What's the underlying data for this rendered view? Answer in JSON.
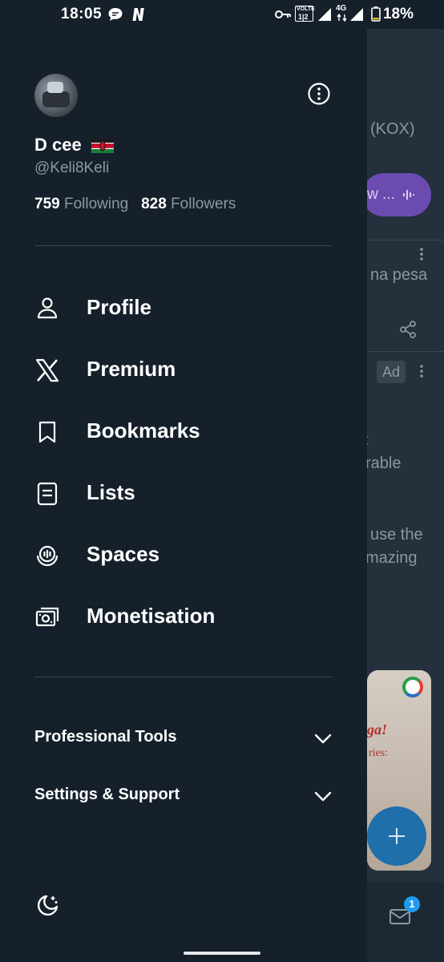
{
  "status_bar": {
    "time": "18:05",
    "battery": "18%",
    "network": "4G",
    "volte": "VOLTE"
  },
  "profile": {
    "name": "D cee",
    "handle": "@Keli8Keli",
    "following_count": "759",
    "following_label": "Following",
    "followers_count": "828",
    "followers_label": "Followers"
  },
  "menu": [
    {
      "label": "Profile",
      "icon": "person-icon"
    },
    {
      "label": "Premium",
      "icon": "x-logo-icon"
    },
    {
      "label": "Bookmarks",
      "icon": "bookmark-icon"
    },
    {
      "label": "Lists",
      "icon": "list-icon"
    },
    {
      "label": "Spaces",
      "icon": "spaces-icon"
    },
    {
      "label": "Monetisation",
      "icon": "money-icon"
    }
  ],
  "sections": [
    {
      "label": "Professional Tools"
    },
    {
      "label": "Settings & Support"
    }
  ],
  "background": {
    "text1": "(KOX)",
    "pill_text": "w ...",
    "text2": "na pesa",
    "ad_badge": "Ad",
    "text3": "t",
    "text4": "rable",
    "text5": "use the",
    "text6": "mazing",
    "card_text1": "ga!",
    "card_text2": "ries:",
    "mail_badge": "1"
  },
  "colors": {
    "background": "#15202b",
    "text_primary": "#ffffff",
    "text_secondary": "#8b98a5",
    "accent": "#1d9bf0"
  }
}
